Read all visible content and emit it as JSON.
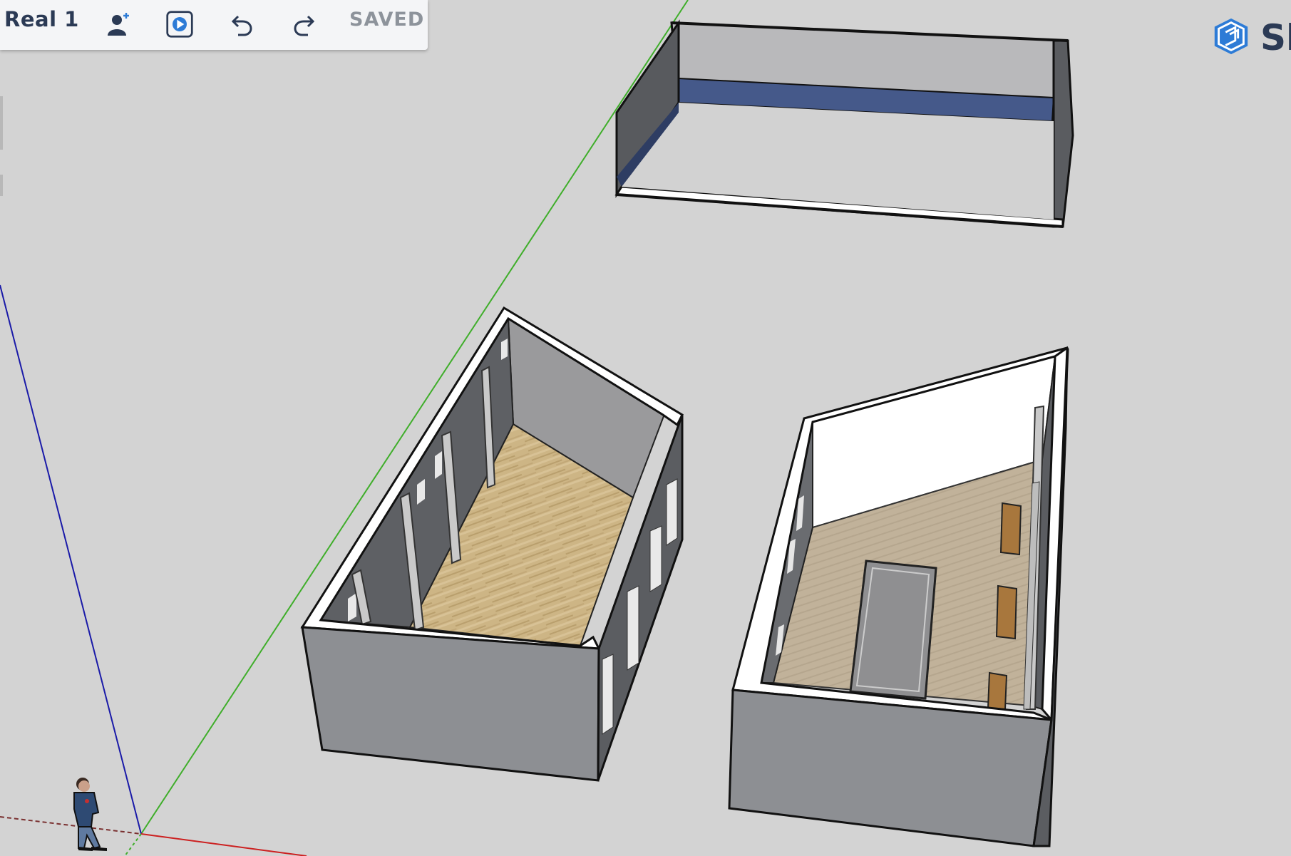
{
  "toolbar": {
    "model_title": "Real 1",
    "add_collaborator_icon": "person-plus-icon",
    "present_icon": "play-icon",
    "undo_icon": "undo-icon",
    "redo_icon": "redo-icon",
    "save_status": "SAVED"
  },
  "brand": {
    "logo_icon": "sketchup-logo-icon",
    "text": "Sk"
  },
  "colors": {
    "background": "#d3d3d3",
    "toolbar_bg": "#f4f5f7",
    "accent": "#2d7bd6",
    "axis_green": "#3fae2a",
    "axis_blue": "#1a1aa8",
    "axis_red": "#cc2020",
    "wall_exterior": "#8d8f93",
    "wall_interior_dark": "#5b5d61",
    "floor_wood": "#c9b07e",
    "floor_tile": "#bfae94",
    "accent_blue_band": "#44598a"
  }
}
